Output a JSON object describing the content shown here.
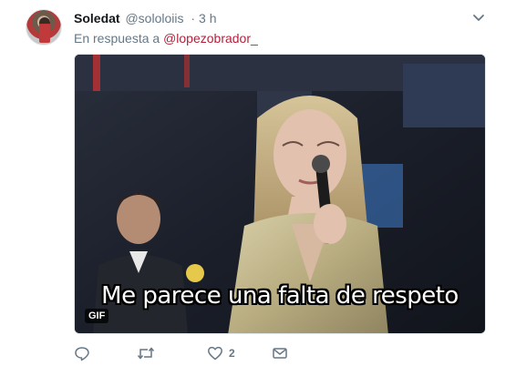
{
  "tweet": {
    "author_name": "Soledat",
    "author_handle": "@sololoiis",
    "separator": "·",
    "time": "3 h",
    "reply_prefix": "En respuesta a",
    "reply_mention": "@lopezobrador_"
  },
  "media": {
    "caption": "Me parece una falta de respeto",
    "badge": "GIF"
  },
  "actions": {
    "reply_icon": "reply-icon",
    "retweet_icon": "retweet-icon",
    "like_icon": "heart-icon",
    "like_count": "2",
    "dm_icon": "envelope-icon"
  },
  "colors": {
    "mention": "#b71f3a",
    "secondary_text": "#657786"
  }
}
